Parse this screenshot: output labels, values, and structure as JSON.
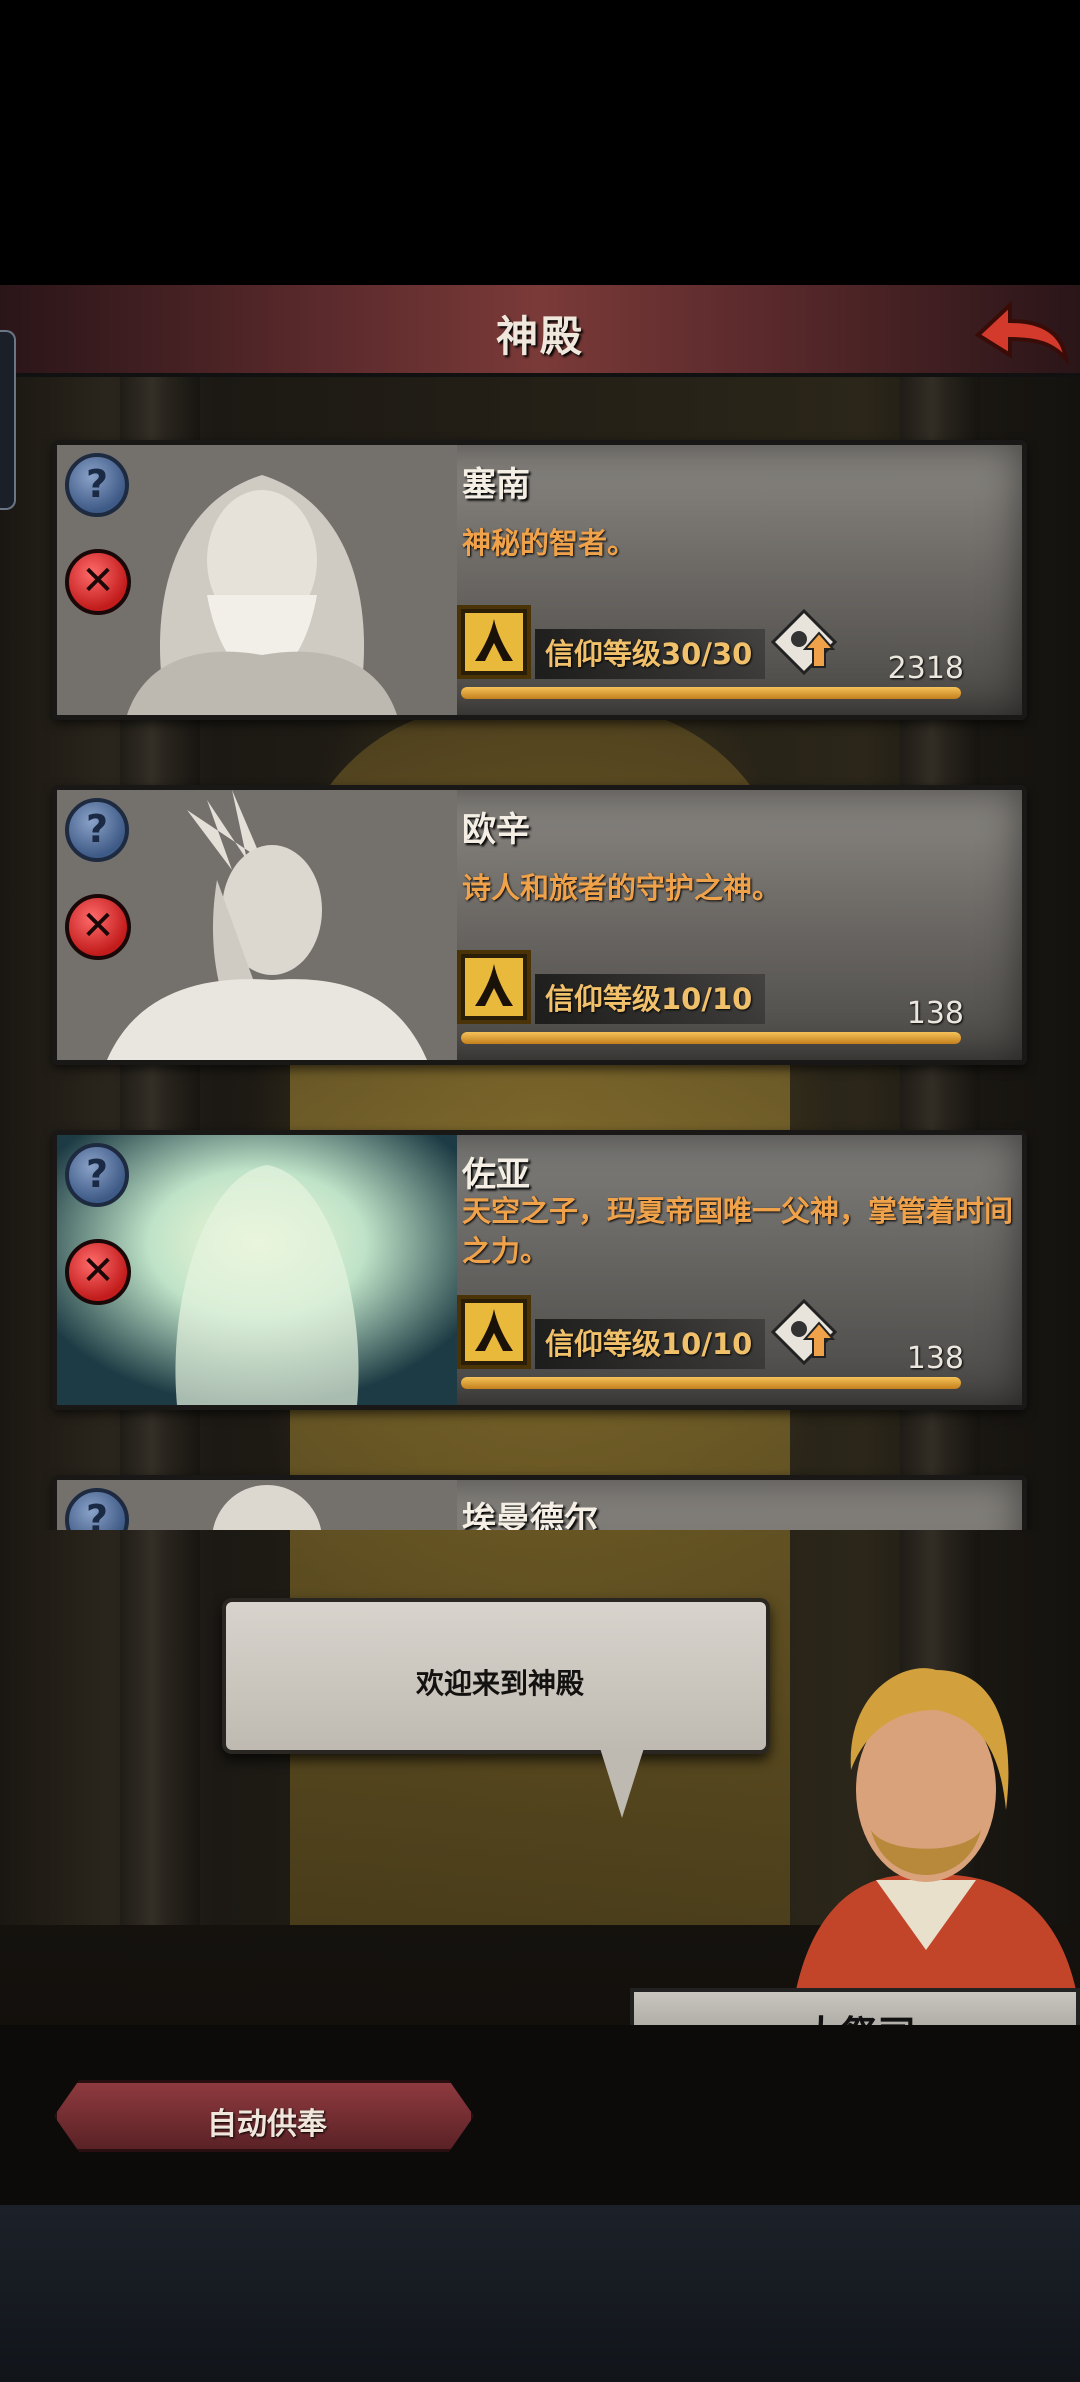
{
  "header": {
    "title": "神殿"
  },
  "gods": [
    {
      "name": "塞南",
      "description": "神秘的智者。",
      "faith_label": "信仰等级30/30",
      "count": "2318",
      "has_upgrade": true,
      "progress": 1.0,
      "portrait": "bearded-sage-statue"
    },
    {
      "name": "欧辛",
      "description": "诗人和旅者的守护之神。",
      "faith_label": "信仰等级10/10",
      "count": "138",
      "has_upgrade": false,
      "progress": 1.0,
      "portrait": "feathered-poet-statue"
    },
    {
      "name": "佐亚",
      "description": "天空之子，玛夏帝国唯一父神，掌管着时间之力。",
      "faith_label": "信仰等级10/10",
      "count": "138",
      "has_upgrade": true,
      "progress": 1.0,
      "portrait": "glowing-spirit"
    },
    {
      "name": "埃曼德尔",
      "portrait": "old-man-statue"
    }
  ],
  "dialog": {
    "text": "欢迎来到神殿"
  },
  "npc": {
    "name": "大祭司"
  },
  "footer": {
    "auto_offer_label": "自动供奉"
  },
  "colors": {
    "accent": "#f0a24a",
    "progress": "#e8a93a",
    "header": "#6b3232"
  }
}
